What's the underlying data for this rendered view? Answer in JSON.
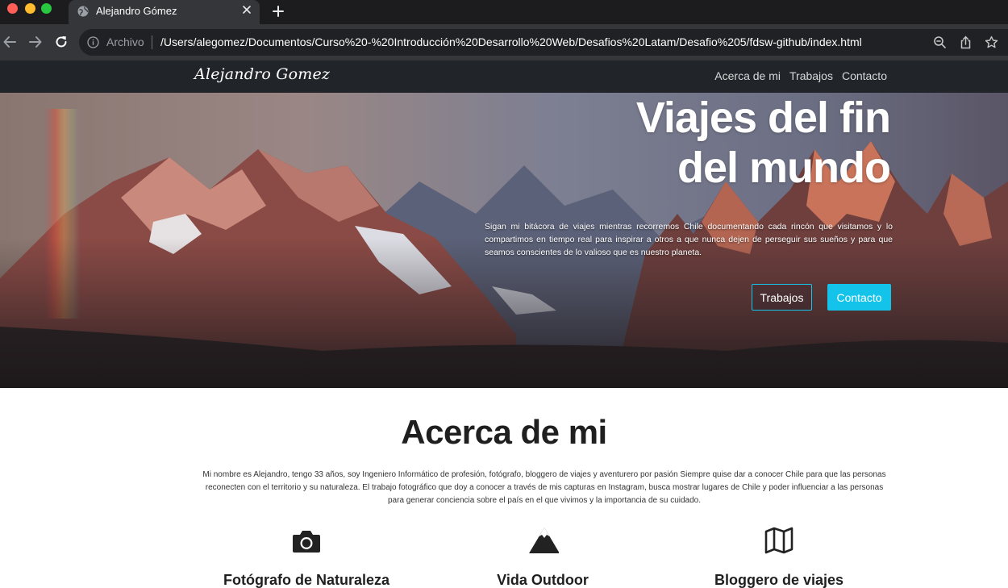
{
  "browser": {
    "tab_title": "Alejandro Gómez",
    "origin_label": "Archivo",
    "url": "/Users/alegomez/Documentos/Curso%20-%20Introducción%20Desarrollo%20Web/Desafios%20Latam/Desafio%205/fdsw-github/index.html",
    "icons": [
      "globe-icon",
      "close-icon",
      "plus-icon",
      "back-arrow-icon",
      "forward-arrow-icon",
      "reload-icon",
      "info-icon",
      "zoom-icon",
      "share-icon",
      "star-icon"
    ],
    "colors": {
      "traffic_red": "#ff5f57",
      "traffic_yellow": "#febc2e",
      "traffic_green": "#28c840"
    }
  },
  "navbar": {
    "brand": "Alejandro Gomez",
    "links": [
      {
        "label": "Acerca de mi"
      },
      {
        "label": "Trabajos"
      },
      {
        "label": "Contacto"
      }
    ]
  },
  "hero": {
    "title_line1": "Viajes del fin",
    "title_line2": "del mundo",
    "text": "Sigan mi bitácora de viajes mientras recorremos Chile documentando cada rincón que visitamos y lo compartimos en tiempo real para inspirar a otros a que nunca dejen de perseguir sus sueños y para que seamos conscientes de lo valioso que es nuestro planeta.",
    "buttons": {
      "trabajos": "Trabajos",
      "contacto": "Contacto"
    },
    "accent_color": "#14c3ea"
  },
  "about": {
    "title": "Acerca de mi",
    "text": "Mi nombre es Alejandro, tengo 33 años, soy Ingeniero Informático de profesión, fotógrafo, bloggero de viajes y aventurero por pasión Siempre quise dar a conocer Chile para que las personas reconecten con el territorio y su naturaleza. El trabajo fotográfico que doy a conocer a través de mis capturas en Instagram, busca mostrar lugares de Chile y poder influenciar a las personas para generar conciencia sobre el país en el que vivimos y la importancia de su cuidado.",
    "features": [
      {
        "icon": "camera-icon",
        "label": "Fotógrafo de Naturaleza"
      },
      {
        "icon": "mountain-icon",
        "label": "Vida Outdoor"
      },
      {
        "icon": "map-icon",
        "label": "Bloggero de viajes"
      }
    ]
  }
}
